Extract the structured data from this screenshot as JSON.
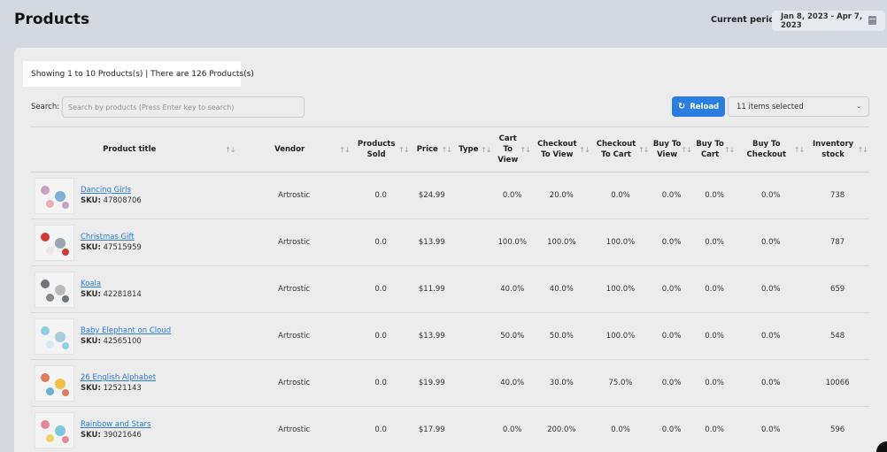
{
  "header": {
    "title": "Products",
    "period_label": "Current period:",
    "period_value": "Jan 8, 2023 - Apr 7, 2023",
    "calendar_icon": "calendar-icon"
  },
  "summary": {
    "text": "Showing 1 to 10 Products(s) | There are 126 Products(s)"
  },
  "search": {
    "label": "Search:",
    "placeholder": "Search by products (Press Enter key to search)",
    "value": ""
  },
  "toolbar": {
    "reload_label": "Reload",
    "reload_icon": "refresh-icon",
    "columns_select_value": "11 items selected",
    "accent_color": "#2a7de1"
  },
  "table": {
    "columns": [
      "Product title",
      "Vendor",
      "Products Sold",
      "Price",
      "Type",
      "Cart To View",
      "Checkout To View",
      "Checkout To Cart",
      "Buy To View",
      "Buy To Cart",
      "Buy To Checkout",
      "Inventory stock"
    ],
    "rows": [
      {
        "name": "Dancing Girls",
        "sku_label": "SKU:",
        "sku": "47808706",
        "vendor": "Artrostic",
        "sold": "0.0",
        "price": "$24.99",
        "type": "",
        "cart_to_view": "0.0%",
        "checkout_to_view": "20.0%",
        "checkout_to_cart": "0.0%",
        "buy_to_view": "0.0%",
        "buy_to_cart": "0.0%",
        "buy_to_checkout": "0.0%",
        "stock": "738"
      },
      {
        "name": "Christmas Gift",
        "sku_label": "SKU:",
        "sku": "47515959",
        "vendor": "Artrostic",
        "sold": "0.0",
        "price": "$13.99",
        "type": "",
        "cart_to_view": "100.0%",
        "checkout_to_view": "100.0%",
        "checkout_to_cart": "100.0%",
        "buy_to_view": "0.0%",
        "buy_to_cart": "0.0%",
        "buy_to_checkout": "0.0%",
        "stock": "787"
      },
      {
        "name": "Koala",
        "sku_label": "SKU:",
        "sku": "42281814",
        "vendor": "Artrostic",
        "sold": "0.0",
        "price": "$11.99",
        "type": "",
        "cart_to_view": "40.0%",
        "checkout_to_view": "40.0%",
        "checkout_to_cart": "100.0%",
        "buy_to_view": "0.0%",
        "buy_to_cart": "0.0%",
        "buy_to_checkout": "0.0%",
        "stock": "659"
      },
      {
        "name": "Baby Elephant on Cloud",
        "sku_label": "SKU:",
        "sku": "42565100",
        "vendor": "Artrostic",
        "sold": "0.0",
        "price": "$13.99",
        "type": "",
        "cart_to_view": "50.0%",
        "checkout_to_view": "50.0%",
        "checkout_to_cart": "100.0%",
        "buy_to_view": "0.0%",
        "buy_to_cart": "0.0%",
        "buy_to_checkout": "0.0%",
        "stock": "548"
      },
      {
        "name": "26 English Alphabet",
        "sku_label": "SKU:",
        "sku": "12521143",
        "vendor": "Artrostic",
        "sold": "0.0",
        "price": "$19.99",
        "type": "",
        "cart_to_view": "40.0%",
        "checkout_to_view": "30.0%",
        "checkout_to_cart": "75.0%",
        "buy_to_view": "0.0%",
        "buy_to_cart": "0.0%",
        "buy_to_checkout": "0.0%",
        "stock": "10066"
      },
      {
        "name": "Rainbow and Stars",
        "sku_label": "SKU:",
        "sku": "39021646",
        "vendor": "Artrostic",
        "sold": "0.0",
        "price": "$17.99",
        "type": "",
        "cart_to_view": "0.0%",
        "checkout_to_view": "200.0%",
        "checkout_to_cart": "0.0%",
        "buy_to_view": "0.0%",
        "buy_to_cart": "0.0%",
        "buy_to_checkout": "0.0%",
        "stock": "596"
      }
    ]
  }
}
